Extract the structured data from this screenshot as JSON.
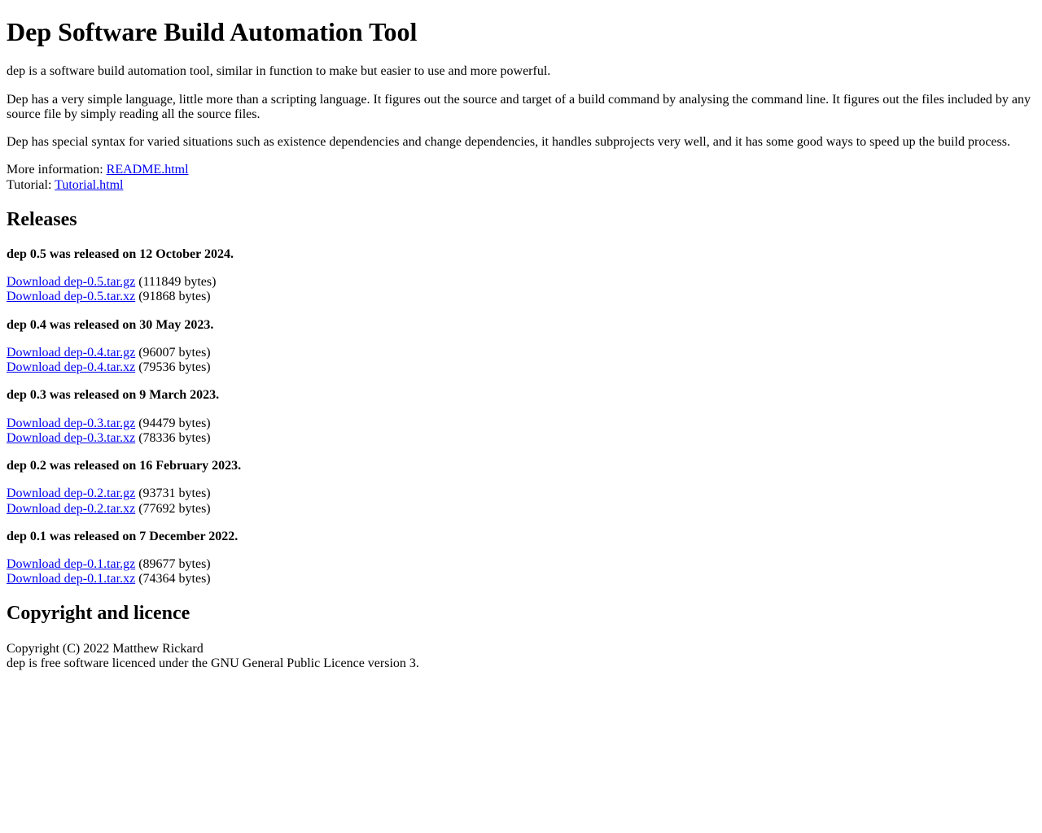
{
  "page": {
    "title": "Dep Software Build Automation Tool",
    "background_color": "#ffffff",
    "text_color": "#000000",
    "link_color": "#0000ee"
  },
  "intro": {
    "paragraph_1": "dep is a software build automation tool, similar in function to make but easier to use and more powerful.",
    "paragraph_2": "Dep has a very simple language, little more than a scripting language. It figures out the source and target of a build command by analysing the command line. It figures out the files included by any source file by simply reading all the source files.",
    "paragraph_3": "Dep has special syntax for varied situations such as existence dependencies and change dependencies, it handles subprojects very well, and it has some good ways to speed up the build process.",
    "more_information_label": "More information:",
    "more_information_link": "README.html",
    "tutorial_label": "Tutorial:",
    "tutorial_link": "Tutorial.html"
  },
  "releases": {
    "heading": "Releases",
    "items": [
      {
        "announcement": "dep 0.5 was released on 12 October 2024.",
        "downloads": [
          {
            "link_text": "Download dep-0.5.tar.gz",
            "size_text": "(111849 bytes)"
          },
          {
            "link_text": "Download dep-0.5.tar.xz",
            "size_text": "(91868 bytes)"
          }
        ]
      },
      {
        "announcement": "dep 0.4 was released on 30 May 2023.",
        "downloads": [
          {
            "link_text": "Download dep-0.4.tar.gz",
            "size_text": "(96007 bytes)"
          },
          {
            "link_text": "Download dep-0.4.tar.xz",
            "size_text": "(79536 bytes)"
          }
        ]
      },
      {
        "announcement": "dep 0.3 was released on 9 March 2023.",
        "downloads": [
          {
            "link_text": "Download dep-0.3.tar.gz",
            "size_text": "(94479 bytes)"
          },
          {
            "link_text": "Download dep-0.3.tar.xz",
            "size_text": "(78336 bytes)"
          }
        ]
      },
      {
        "announcement": "dep 0.2 was released on 16 February 2023.",
        "downloads": [
          {
            "link_text": "Download dep-0.2.tar.gz",
            "size_text": "(93731 bytes)"
          },
          {
            "link_text": "Download dep-0.2.tar.xz",
            "size_text": "(77692 bytes)"
          }
        ]
      },
      {
        "announcement": "dep 0.1 was released on 7 December 2022.",
        "downloads": [
          {
            "link_text": "Download dep-0.1.tar.gz",
            "size_text": "(89677 bytes)"
          },
          {
            "link_text": "Download dep-0.1.tar.xz",
            "size_text": "(74364 bytes)"
          }
        ]
      }
    ]
  },
  "copyright": {
    "heading": "Copyright and licence",
    "line_1": "Copyright (C) 2022 Matthew Rickard",
    "line_2": "dep is free software licenced under the GNU General Public Licence version 3."
  }
}
